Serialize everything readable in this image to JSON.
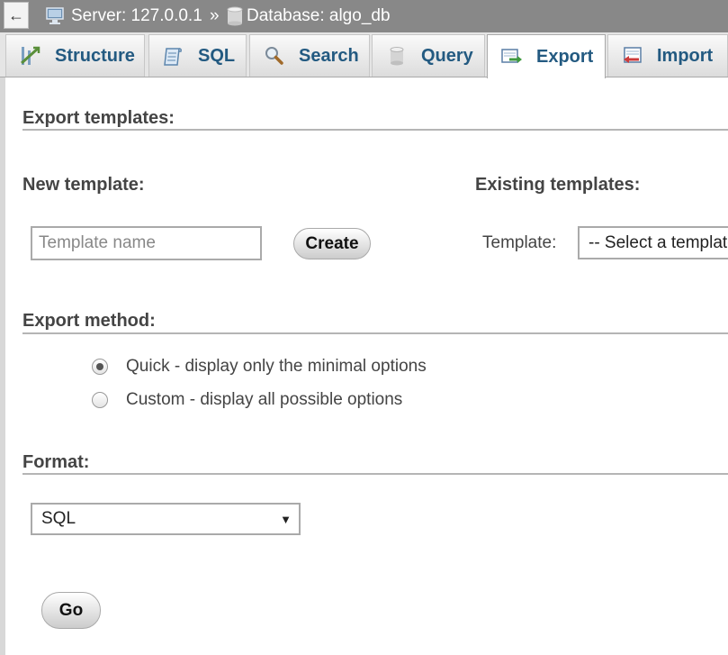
{
  "breadcrumb": {
    "back_icon": "left-arrow-icon",
    "server_label": "Server: 127.0.0.1",
    "separator": "»",
    "database_label": "Database: algo_db"
  },
  "tabs": [
    {
      "label": "Structure",
      "icon": "structure-icon",
      "active": false
    },
    {
      "label": "SQL",
      "icon": "sql-icon",
      "active": false
    },
    {
      "label": "Search",
      "icon": "search-icon",
      "active": false
    },
    {
      "label": "Query",
      "icon": "query-icon",
      "active": false
    },
    {
      "label": "Export",
      "icon": "export-icon",
      "active": true
    },
    {
      "label": "Import",
      "icon": "import-icon",
      "active": false
    }
  ],
  "templates": {
    "section_title": "Export templates:",
    "new_label": "New template:",
    "existing_label": "Existing templates:",
    "name_placeholder": "Template name",
    "name_value": "",
    "create_label": "Create",
    "template_label": "Template:",
    "template_select_value": "-- Select a template --"
  },
  "export_method": {
    "section_title": "Export method:",
    "options": [
      {
        "label": "Quick - display only the minimal options",
        "checked": true
      },
      {
        "label": "Custom - display all possible options",
        "checked": false
      }
    ]
  },
  "format": {
    "section_title": "Format:",
    "selected": "SQL"
  },
  "go_label": "Go",
  "colors": {
    "topbar": "#888888",
    "tab_text": "#235a81",
    "rule": "#b5b5b5"
  }
}
